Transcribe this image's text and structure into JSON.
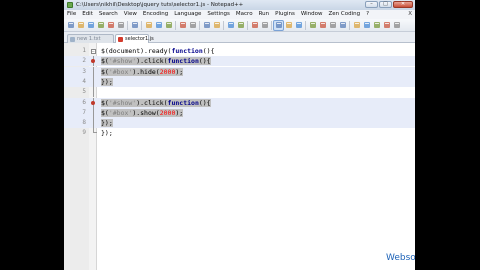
{
  "window": {
    "title": "C:\\Users\\nikhil\\Desktop\\jquery tuts\\selector1.js - Notepad++",
    "minimize": "–",
    "maximize": "□",
    "close": "✕"
  },
  "menu": {
    "items": [
      "File",
      "Edit",
      "Search",
      "View",
      "Encoding",
      "Language",
      "Settings",
      "Macro",
      "Run",
      "Plugins",
      "Window",
      "Zen Coding",
      "?"
    ],
    "close_label": "X"
  },
  "toolbar": {
    "icons": [
      "new-file-icon",
      "open-folder-icon",
      "save-icon",
      "save-all-icon",
      "close-file-icon",
      "close-all-icon",
      "print-icon",
      "cut-icon",
      "copy-icon",
      "paste-icon",
      "undo-icon",
      "redo-icon",
      "find-icon",
      "replace-icon",
      "zoom-in-icon",
      "zoom-out-icon",
      "sync-v-icon",
      "sync-h-icon",
      "word-wrap-icon",
      "show-all-chars-icon",
      "indent-guide-icon",
      "user-lang-icon",
      "doc-map-icon",
      "function-list-icon",
      "folder-workspace-icon",
      "record-macro-icon",
      "stop-record-icon",
      "play-macro-icon",
      "run-macro-multiple-icon",
      "save-macro-icon"
    ],
    "active_icon": "word-wrap-icon"
  },
  "tabs": [
    {
      "label": "new 1.txt",
      "active": false
    },
    {
      "label": "selector1.js",
      "active": true
    }
  ],
  "editor": {
    "lines": [
      {
        "n": "1",
        "text": "$(document).ready(function(){"
      },
      {
        "n": "2",
        "text": "$('#show').click(function(){"
      },
      {
        "n": "3",
        "text": "$('#box').hide(2000);"
      },
      {
        "n": "4",
        "text": "});"
      },
      {
        "n": "5",
        "text": ""
      },
      {
        "n": "6",
        "text": "$('#show').click(function(){"
      },
      {
        "n": "7",
        "text": "$('#box').show(2000);"
      },
      {
        "n": "8",
        "text": "});"
      },
      {
        "n": "9",
        "text": "});"
      }
    ]
  },
  "watermark": "Websofttutorials.com",
  "colors": {
    "keyword": "#00008b",
    "string": "#7f7f7f",
    "number": "#ff0000",
    "line_highlight": "#e7ecf9",
    "watermark": "#1e63b8"
  }
}
